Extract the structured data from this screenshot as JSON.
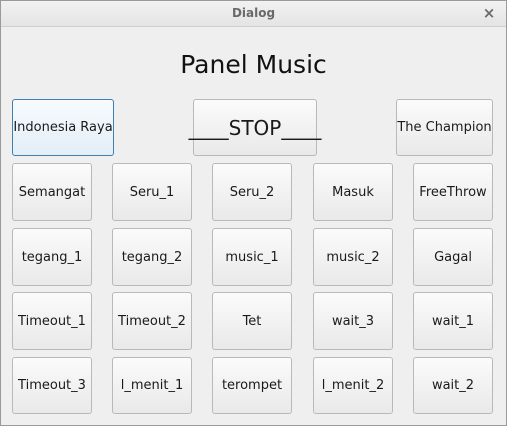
{
  "window": {
    "title": "Dialog",
    "close_icon": "×"
  },
  "heading": "Panel Music",
  "top_row": {
    "left": "Indonesia Raya",
    "center": "____STOP____",
    "right": "The Champion"
  },
  "grid": [
    [
      "Semangat",
      "Seru_1",
      "Seru_2",
      "Masuk",
      "FreeThrow"
    ],
    [
      "tegang_1",
      "tegang_2",
      "music_1",
      "music_2",
      "Gagal"
    ],
    [
      "Timeout_1",
      "Timeout_2",
      "Tet",
      "wait_3",
      "wait_1"
    ],
    [
      "Timeout_3",
      "l_menit_1",
      "terompet",
      "l_menit_2",
      "wait_2"
    ]
  ]
}
